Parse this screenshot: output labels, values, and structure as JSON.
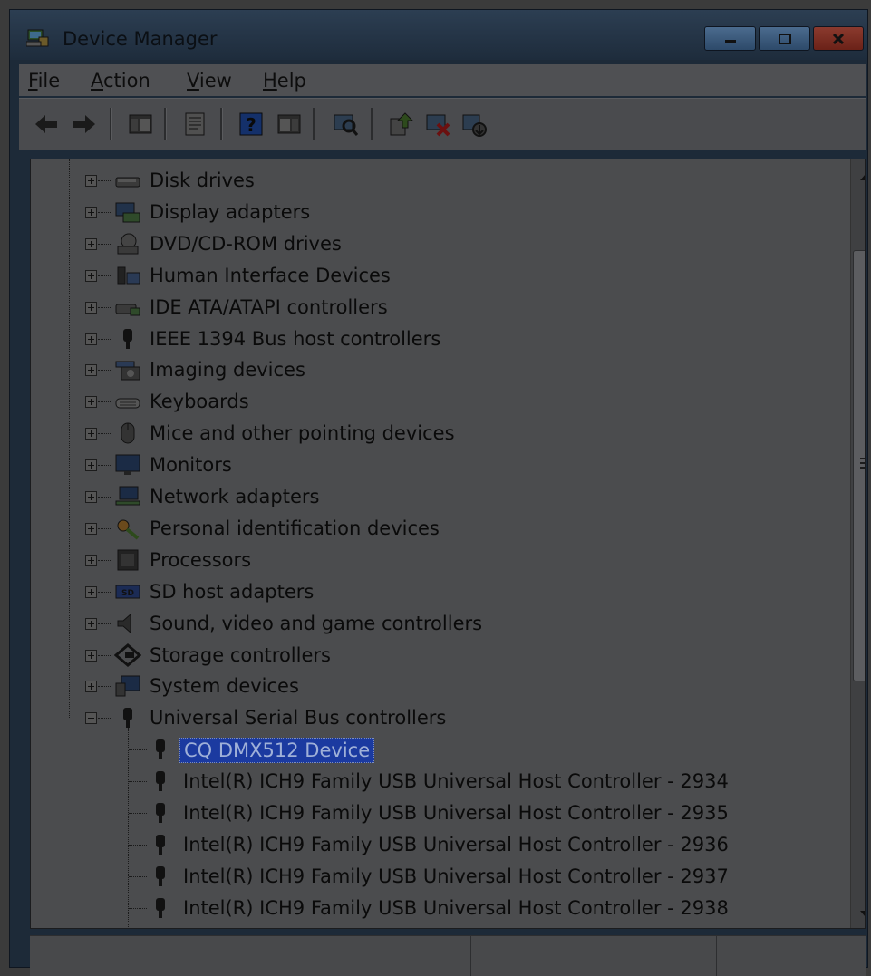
{
  "window": {
    "title": "Device Manager"
  },
  "menu": [
    {
      "label": "File",
      "key": "F"
    },
    {
      "label": "Action",
      "key": "A"
    },
    {
      "label": "View",
      "key": "V"
    },
    {
      "label": "Help",
      "key": "H"
    }
  ],
  "toolbar": [
    "back-icon",
    "forward-icon",
    "show-hide-console-tree-icon",
    "properties-icon",
    "help-icon",
    "console-tree-icon",
    "scan-hardware-icon",
    "update-driver-icon",
    "uninstall-icon",
    "disable-icon"
  ],
  "tree": {
    "categories": [
      {
        "label": "Disk drives",
        "icon": "disk-drive-icon"
      },
      {
        "label": "Display adapters",
        "icon": "display-adapter-icon"
      },
      {
        "label": "DVD/CD-ROM drives",
        "icon": "dvd-drive-icon"
      },
      {
        "label": "Human Interface Devices",
        "icon": "hid-icon"
      },
      {
        "label": "IDE ATA/ATAPI controllers",
        "icon": "ide-controller-icon"
      },
      {
        "label": "IEEE 1394 Bus host controllers",
        "icon": "ieee1394-icon"
      },
      {
        "label": "Imaging devices",
        "icon": "camera-icon"
      },
      {
        "label": "Keyboards",
        "icon": "keyboard-icon"
      },
      {
        "label": "Mice and other pointing devices",
        "icon": "mouse-icon"
      },
      {
        "label": "Monitors",
        "icon": "monitor-icon"
      },
      {
        "label": "Network adapters",
        "icon": "network-icon"
      },
      {
        "label": "Personal identification devices",
        "icon": "fingerprint-icon"
      },
      {
        "label": "Processors",
        "icon": "processor-icon"
      },
      {
        "label": "SD host adapters",
        "icon": "sd-card-icon"
      },
      {
        "label": "Sound, video and game controllers",
        "icon": "speaker-icon"
      },
      {
        "label": "Storage controllers",
        "icon": "storage-icon"
      },
      {
        "label": "System devices",
        "icon": "system-icon"
      },
      {
        "label": "Universal Serial Bus controllers",
        "icon": "usb-icon",
        "expanded": true
      }
    ],
    "usb_children": [
      {
        "label": "CQ DMX512 Device",
        "selected": true
      },
      {
        "label": "Intel(R) ICH9 Family USB Universal Host Controller - 2934"
      },
      {
        "label": "Intel(R) ICH9 Family USB Universal Host Controller - 2935"
      },
      {
        "label": "Intel(R) ICH9 Family USB Universal Host Controller - 2936"
      },
      {
        "label": "Intel(R) ICH9 Family USB Universal Host Controller - 2937"
      },
      {
        "label": "Intel(R) ICH9 Family USB Universal Host Controller - 2938"
      }
    ]
  },
  "colors": {
    "selection": "#1b3aa0",
    "window_frame": "#1d2a38",
    "close_button": "#8b3a2e"
  }
}
